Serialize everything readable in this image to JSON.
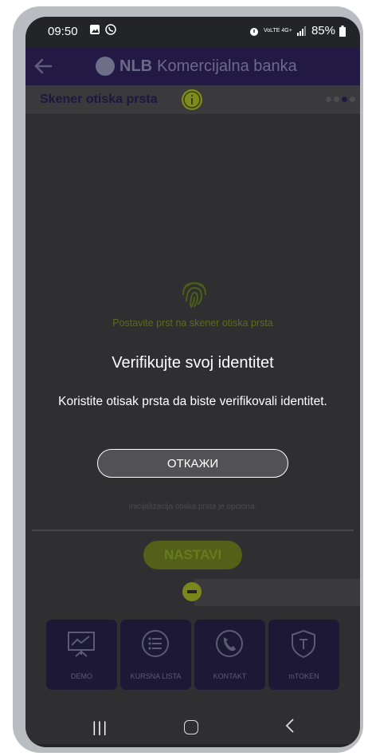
{
  "status_bar": {
    "time": "09:50",
    "network": "VoLTE 4G+",
    "battery": "85%"
  },
  "header": {
    "brand_bold": "NLB",
    "brand_rest": "Komercijalna banka"
  },
  "step": {
    "title": "Skener otiska prsta"
  },
  "content": {
    "fingerprint_hint": "Postavite prst na skener otiska prsta",
    "init_note": "Inicijalizacija otiska prsta je opciona.",
    "continue_label": "NASTAVI"
  },
  "dialog": {
    "title": "Verifikujte svoj identitet",
    "message": "Koristite otisak prsta da biste verifikovali identitet.",
    "cancel_label": "ОТКАЖИ"
  },
  "bottom_tabs": [
    {
      "label": "DEMO",
      "icon": "presentation-chart-icon"
    },
    {
      "label": "KURSNA LISTA",
      "icon": "list-icon"
    },
    {
      "label": "KONTAKT",
      "icon": "phone-icon"
    },
    {
      "label": "mTOKEN",
      "icon": "shield-icon"
    }
  ],
  "colors": {
    "header_bg": "#221a45",
    "accent_green": "#7e8c1d",
    "tab_bg": "#1c1836"
  }
}
